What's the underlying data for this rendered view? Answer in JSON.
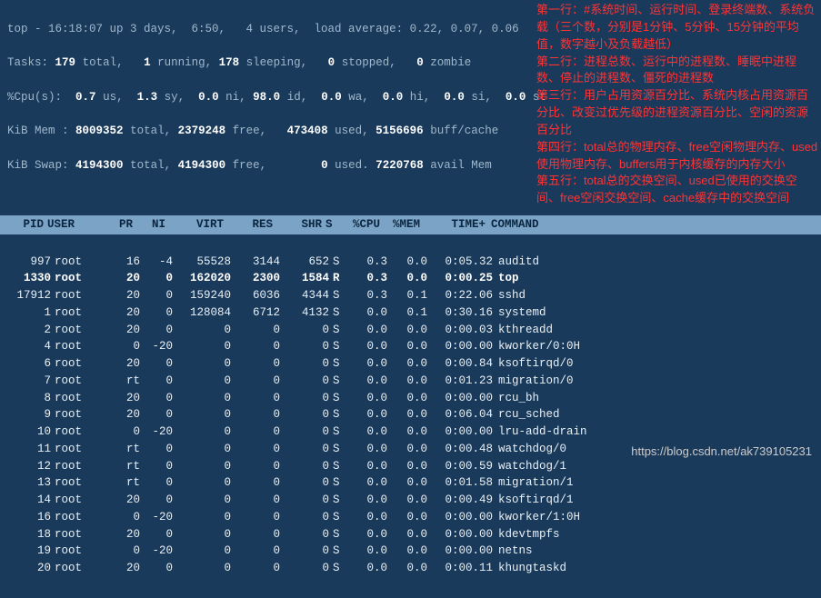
{
  "summary": {
    "line1_a": "top - 16:18:07 up 3 days,  6:50,   4 users,  load average: 0.22, 0.07, 0.06",
    "tasks": {
      "label": "Tasks:",
      "total": "179",
      "running": "1",
      "sleeping": "178",
      "stopped": "0",
      "zombie": "0"
    },
    "cpu": {
      "label": "%Cpu(s):",
      "us": "0.7",
      "sy": "1.3",
      "ni": "0.0",
      "id": "98.0",
      "wa": "0.0",
      "hi": "0.0",
      "si": "0.0",
      "st": "0.0"
    },
    "mem": {
      "label": "KiB Mem :",
      "total": "8009352",
      "free": "2379248",
      "used": "473408",
      "buff": "5156696"
    },
    "swap": {
      "label": "KiB Swap:",
      "total": "4194300",
      "free": "4194300",
      "used": "0",
      "avail": "7220768"
    }
  },
  "headers": {
    "pid": "PID",
    "user": "USER",
    "pr": "PR",
    "ni": "NI",
    "virt": "VIRT",
    "res": "RES",
    "shr": "SHR",
    "s": "S",
    "cpu": "%CPU",
    "mem": "%MEM",
    "time": "TIME+",
    "cmd": "COMMAND"
  },
  "rows": [
    {
      "pid": "997",
      "user": "root",
      "pr": "16",
      "ni": "-4",
      "virt": "55528",
      "res": "3144",
      "shr": "652",
      "s": "S",
      "cpu": "0.3",
      "mem": "0.0",
      "time": "0:05.32",
      "cmd": "auditd",
      "hi": false
    },
    {
      "pid": "1330",
      "user": "root",
      "pr": "20",
      "ni": "0",
      "virt": "162020",
      "res": "2300",
      "shr": "1584",
      "s": "R",
      "cpu": "0.3",
      "mem": "0.0",
      "time": "0:00.25",
      "cmd": "top",
      "hi": true
    },
    {
      "pid": "17912",
      "user": "root",
      "pr": "20",
      "ni": "0",
      "virt": "159240",
      "res": "6036",
      "shr": "4344",
      "s": "S",
      "cpu": "0.3",
      "mem": "0.1",
      "time": "0:22.06",
      "cmd": "sshd",
      "hi": false
    },
    {
      "pid": "1",
      "user": "root",
      "pr": "20",
      "ni": "0",
      "virt": "128084",
      "res": "6712",
      "shr": "4132",
      "s": "S",
      "cpu": "0.0",
      "mem": "0.1",
      "time": "0:30.16",
      "cmd": "systemd",
      "hi": false
    },
    {
      "pid": "2",
      "user": "root",
      "pr": "20",
      "ni": "0",
      "virt": "0",
      "res": "0",
      "shr": "0",
      "s": "S",
      "cpu": "0.0",
      "mem": "0.0",
      "time": "0:00.03",
      "cmd": "kthreadd",
      "hi": false
    },
    {
      "pid": "4",
      "user": "root",
      "pr": "0",
      "ni": "-20",
      "virt": "0",
      "res": "0",
      "shr": "0",
      "s": "S",
      "cpu": "0.0",
      "mem": "0.0",
      "time": "0:00.00",
      "cmd": "kworker/0:0H",
      "hi": false
    },
    {
      "pid": "6",
      "user": "root",
      "pr": "20",
      "ni": "0",
      "virt": "0",
      "res": "0",
      "shr": "0",
      "s": "S",
      "cpu": "0.0",
      "mem": "0.0",
      "time": "0:00.84",
      "cmd": "ksoftirqd/0",
      "hi": false
    },
    {
      "pid": "7",
      "user": "root",
      "pr": "rt",
      "ni": "0",
      "virt": "0",
      "res": "0",
      "shr": "0",
      "s": "S",
      "cpu": "0.0",
      "mem": "0.0",
      "time": "0:01.23",
      "cmd": "migration/0",
      "hi": false
    },
    {
      "pid": "8",
      "user": "root",
      "pr": "20",
      "ni": "0",
      "virt": "0",
      "res": "0",
      "shr": "0",
      "s": "S",
      "cpu": "0.0",
      "mem": "0.0",
      "time": "0:00.00",
      "cmd": "rcu_bh",
      "hi": false
    },
    {
      "pid": "9",
      "user": "root",
      "pr": "20",
      "ni": "0",
      "virt": "0",
      "res": "0",
      "shr": "0",
      "s": "S",
      "cpu": "0.0",
      "mem": "0.0",
      "time": "0:06.04",
      "cmd": "rcu_sched",
      "hi": false
    },
    {
      "pid": "10",
      "user": "root",
      "pr": "0",
      "ni": "-20",
      "virt": "0",
      "res": "0",
      "shr": "0",
      "s": "S",
      "cpu": "0.0",
      "mem": "0.0",
      "time": "0:00.00",
      "cmd": "lru-add-drain",
      "hi": false
    },
    {
      "pid": "11",
      "user": "root",
      "pr": "rt",
      "ni": "0",
      "virt": "0",
      "res": "0",
      "shr": "0",
      "s": "S",
      "cpu": "0.0",
      "mem": "0.0",
      "time": "0:00.48",
      "cmd": "watchdog/0",
      "hi": false
    },
    {
      "pid": "12",
      "user": "root",
      "pr": "rt",
      "ni": "0",
      "virt": "0",
      "res": "0",
      "shr": "0",
      "s": "S",
      "cpu": "0.0",
      "mem": "0.0",
      "time": "0:00.59",
      "cmd": "watchdog/1",
      "hi": false
    },
    {
      "pid": "13",
      "user": "root",
      "pr": "rt",
      "ni": "0",
      "virt": "0",
      "res": "0",
      "shr": "0",
      "s": "S",
      "cpu": "0.0",
      "mem": "0.0",
      "time": "0:01.58",
      "cmd": "migration/1",
      "hi": false
    },
    {
      "pid": "14",
      "user": "root",
      "pr": "20",
      "ni": "0",
      "virt": "0",
      "res": "0",
      "shr": "0",
      "s": "S",
      "cpu": "0.0",
      "mem": "0.0",
      "time": "0:00.49",
      "cmd": "ksoftirqd/1",
      "hi": false
    },
    {
      "pid": "16",
      "user": "root",
      "pr": "0",
      "ni": "-20",
      "virt": "0",
      "res": "0",
      "shr": "0",
      "s": "S",
      "cpu": "0.0",
      "mem": "0.0",
      "time": "0:00.00",
      "cmd": "kworker/1:0H",
      "hi": false
    },
    {
      "pid": "18",
      "user": "root",
      "pr": "20",
      "ni": "0",
      "virt": "0",
      "res": "0",
      "shr": "0",
      "s": "S",
      "cpu": "0.0",
      "mem": "0.0",
      "time": "0:00.00",
      "cmd": "kdevtmpfs",
      "hi": false
    },
    {
      "pid": "19",
      "user": "root",
      "pr": "0",
      "ni": "-20",
      "virt": "0",
      "res": "0",
      "shr": "0",
      "s": "S",
      "cpu": "0.0",
      "mem": "0.0",
      "time": "0:00.00",
      "cmd": "netns",
      "hi": false
    },
    {
      "pid": "20",
      "user": "root",
      "pr": "20",
      "ni": "0",
      "virt": "0",
      "res": "0",
      "shr": "0",
      "s": "S",
      "cpu": "0.0",
      "mem": "0.0",
      "time": "0:00.11",
      "cmd": "khungtaskd",
      "hi": false
    }
  ],
  "annotations": [
    "第一行：#系统时间、运行时间、登录终端数、系统负载（三个数，分别是1分钟、5分钟、15分钟的平均值，数字越小及负载越低）",
    "第二行：进程总数、运行中的进程数、睡眠中进程数、停止的进程数、僵死的进程数",
    "第三行：用户占用资源百分比、系统内核占用资源百分比、改变过优先级的进程资源百分比、空闲的资源百分比",
    "第四行：total总的物理内存、free空闲物理内存、used使用物理内存、buffers用于内核缓存的内存大小",
    "第五行：total总的交换空间、used已使用的交换空间、free空闲交换空间、cache缓存中的交换空间"
  ],
  "watermark": "https://blog.csdn.net/ak739105231"
}
